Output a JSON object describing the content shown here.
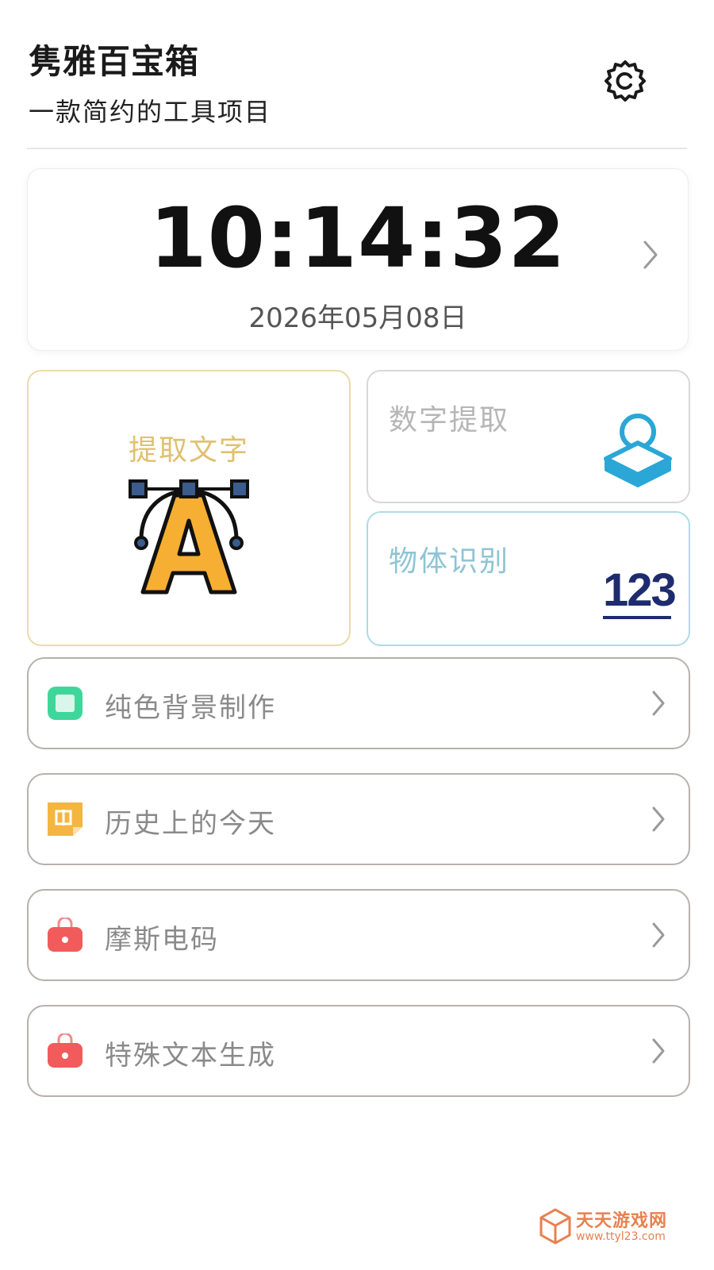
{
  "header": {
    "title": "隽雅百宝箱",
    "subtitle": "一款简约的工具项目",
    "settings_icon": "gear-icon"
  },
  "clock": {
    "time": "10:14:32",
    "date": "2026年05月08日"
  },
  "tiles": {
    "extract_text": {
      "label": "提取文字",
      "icon": "vector-letter-a-icon",
      "accent": "#e0c070"
    },
    "digit_extract": {
      "label": "数字提取",
      "icon": "stamp-icon",
      "accent": "#b6b6b6"
    },
    "object_recognition": {
      "label": "物体识别",
      "icon_text": "123",
      "accent": "#8fc4d4"
    }
  },
  "list": [
    {
      "label": "纯色背景制作",
      "icon": "solid-color-square-icon",
      "icon_color": "#3fd69a"
    },
    {
      "label": "历史上的今天",
      "icon": "calendar-note-icon",
      "icon_color": "#f4b640"
    },
    {
      "label": "摩斯电码",
      "icon": "red-bag-icon",
      "icon_color": "#f25b5b"
    },
    {
      "label": "特殊文本生成",
      "icon": "red-bag-icon",
      "icon_color": "#f25b5b"
    }
  ],
  "watermark": {
    "title": "天天游戏网",
    "url": "www.ttyl23.com"
  }
}
